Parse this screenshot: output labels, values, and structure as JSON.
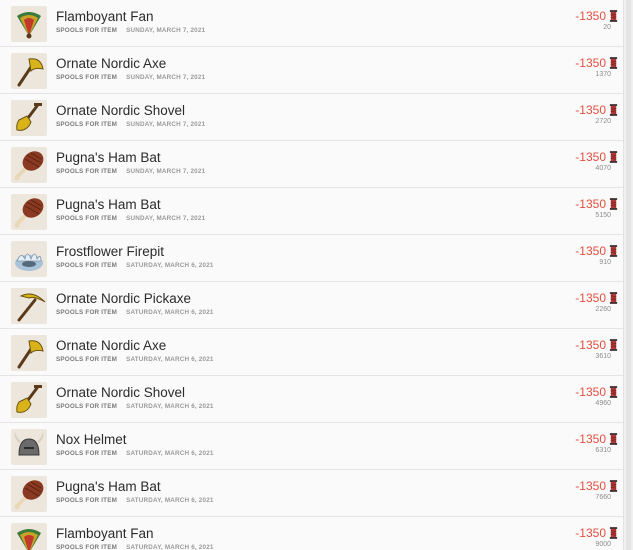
{
  "currency": {
    "icon": "spool-icon",
    "color": "#e44e3e"
  },
  "transactions": [
    {
      "item": "Flamboyant Fan",
      "type": "SPOOLS FOR ITEM",
      "date": "SUNDAY, MARCH 7, 2021",
      "amount": "-1350",
      "balance": "20",
      "icon": "fan-icon"
    },
    {
      "item": "Ornate Nordic Axe",
      "type": "SPOOLS FOR ITEM",
      "date": "SUNDAY, MARCH 7, 2021",
      "amount": "-1350",
      "balance": "1370",
      "icon": "axe-icon"
    },
    {
      "item": "Ornate Nordic Shovel",
      "type": "SPOOLS FOR ITEM",
      "date": "SUNDAY, MARCH 7, 2021",
      "amount": "-1350",
      "balance": "2720",
      "icon": "shovel-icon"
    },
    {
      "item": "Pugna's Ham Bat",
      "type": "SPOOLS FOR ITEM",
      "date": "SUNDAY, MARCH 7, 2021",
      "amount": "-1350",
      "balance": "4070",
      "icon": "ham-bat-icon"
    },
    {
      "item": "Pugna's Ham Bat",
      "type": "SPOOLS FOR ITEM",
      "date": "SUNDAY, MARCH 7, 2021",
      "amount": "-1350",
      "balance": "5150",
      "icon": "ham-bat-icon"
    },
    {
      "item": "Frostflower Firepit",
      "type": "SPOOLS FOR ITEM",
      "date": "SATURDAY, MARCH 6, 2021",
      "amount": "-1350",
      "balance": "910",
      "icon": "firepit-icon"
    },
    {
      "item": "Ornate Nordic Pickaxe",
      "type": "SPOOLS FOR ITEM",
      "date": "SATURDAY, MARCH 6, 2021",
      "amount": "-1350",
      "balance": "2260",
      "icon": "pickaxe-icon"
    },
    {
      "item": "Ornate Nordic Axe",
      "type": "SPOOLS FOR ITEM",
      "date": "SATURDAY, MARCH 6, 2021",
      "amount": "-1350",
      "balance": "3610",
      "icon": "axe-icon"
    },
    {
      "item": "Ornate Nordic Shovel",
      "type": "SPOOLS FOR ITEM",
      "date": "SATURDAY, MARCH 6, 2021",
      "amount": "-1350",
      "balance": "4960",
      "icon": "shovel-icon"
    },
    {
      "item": "Nox Helmet",
      "type": "SPOOLS FOR ITEM",
      "date": "SATURDAY, MARCH 6, 2021",
      "amount": "-1350",
      "balance": "6310",
      "icon": "helmet-icon"
    },
    {
      "item": "Pugna's Ham Bat",
      "type": "SPOOLS FOR ITEM",
      "date": "SATURDAY, MARCH 6, 2021",
      "amount": "-1350",
      "balance": "7660",
      "icon": "ham-bat-icon"
    },
    {
      "item": "Flamboyant Fan",
      "type": "SPOOLS FOR ITEM",
      "date": "SATURDAY, MARCH 6, 2021",
      "amount": "-1350",
      "balance": "9000",
      "icon": "fan-icon"
    }
  ]
}
